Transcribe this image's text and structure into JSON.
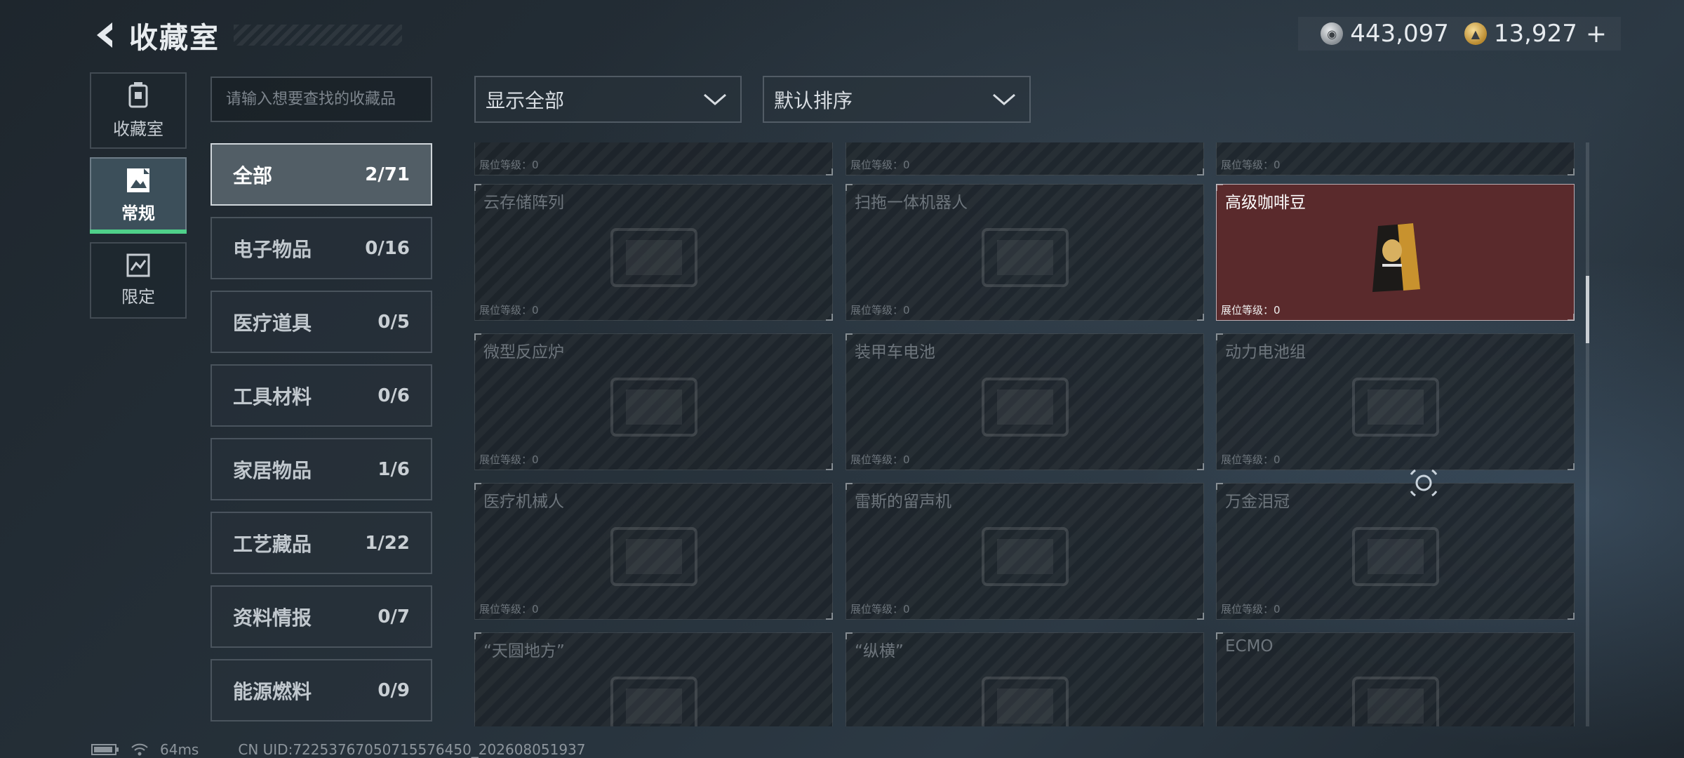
{
  "header": {
    "title": "收藏室"
  },
  "currency": {
    "silver": "443,097",
    "gold": "13,927",
    "plus": "+"
  },
  "tabs": [
    {
      "label": "收藏室",
      "icon": "trash-bin-icon"
    },
    {
      "label": "常规",
      "icon": "picture-icon",
      "active": true
    },
    {
      "label": "限定",
      "icon": "chart-icon"
    }
  ],
  "search": {
    "placeholder": "请输入想要查找的收藏品"
  },
  "categories": [
    {
      "name": "全部",
      "count": "2/71",
      "active": true
    },
    {
      "name": "电子物品",
      "count": "0/16"
    },
    {
      "name": "医疗道具",
      "count": "0/5"
    },
    {
      "name": "工具材料",
      "count": "0/6"
    },
    {
      "name": "家居物品",
      "count": "1/6"
    },
    {
      "name": "工艺藏品",
      "count": "1/22"
    },
    {
      "name": "资料情报",
      "count": "0/7"
    },
    {
      "name": "能源燃料",
      "count": "0/9"
    }
  ],
  "filters": {
    "show": "显示全部",
    "sort": "默认排序"
  },
  "level_label": "展位等级：0",
  "items": [
    {
      "name": ""
    },
    {
      "name": ""
    },
    {
      "name": ""
    },
    {
      "name": "云存储阵列"
    },
    {
      "name": "扫拖一体机器人"
    },
    {
      "name": "高级咖啡豆",
      "owned": true
    },
    {
      "name": "微型反应炉"
    },
    {
      "name": "装甲车电池"
    },
    {
      "name": "动力电池组"
    },
    {
      "name": "医疗机械人"
    },
    {
      "name": "雷斯的留声机"
    },
    {
      "name": "万金泪冠"
    },
    {
      "name": "“天圆地方”"
    },
    {
      "name": "“纵横”"
    },
    {
      "name": "ECMO"
    }
  ],
  "footer": {
    "ping": "64ms",
    "uid": "CN UID:7225376705071557​6450_202608051937"
  },
  "colors": {
    "accent_green": "#4fd08a",
    "owned_card": "#5a2a2c"
  }
}
